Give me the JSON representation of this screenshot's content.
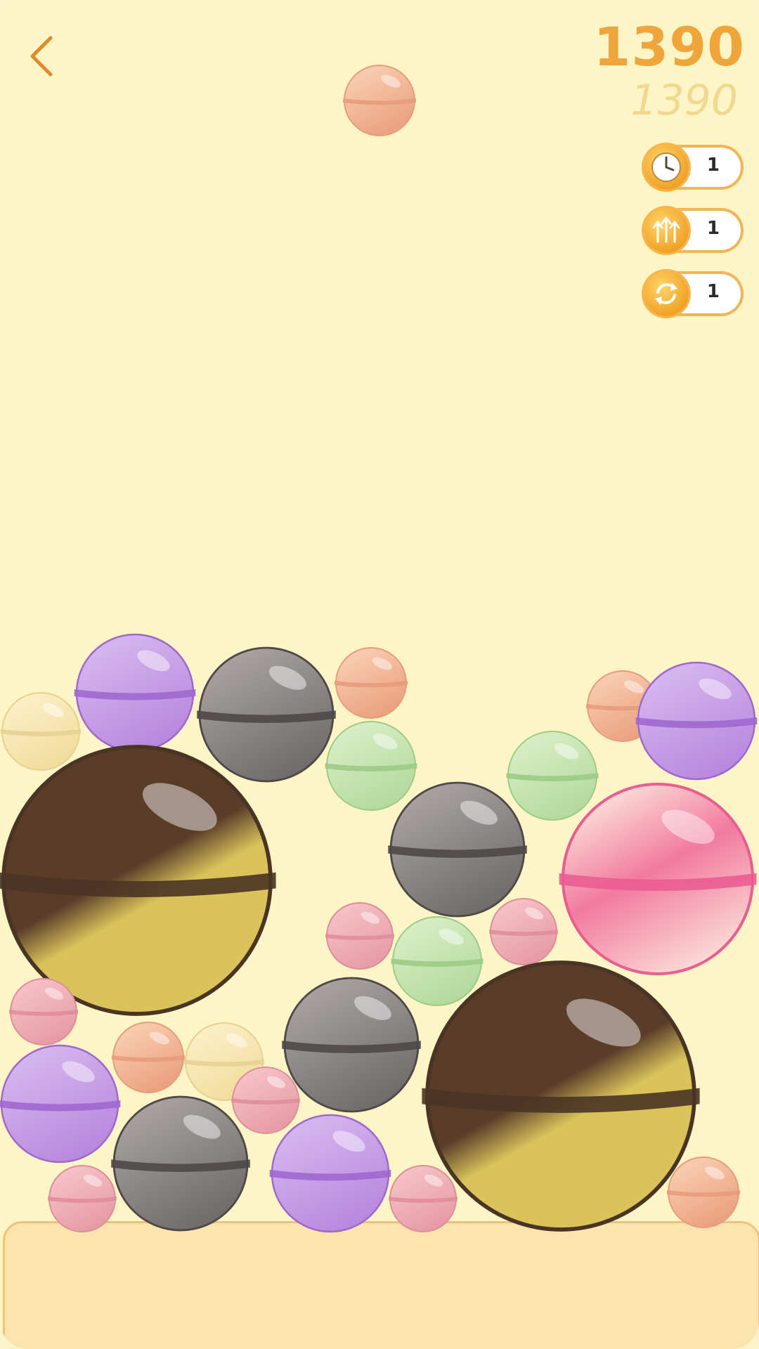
{
  "score": {
    "current": "1390",
    "best": "1390"
  },
  "powerups": [
    {
      "icon": "clock-icon",
      "count": "1"
    },
    {
      "icon": "arrows-up-icon",
      "count": "1"
    },
    {
      "icon": "refresh-icon",
      "count": "1"
    }
  ],
  "colors": {
    "background": "#fef5c6",
    "score": "#f0a53a",
    "best_score": "#f1d890",
    "floor": "#fde3ad",
    "back_arrow": "#e08a2a"
  },
  "ball_types": {
    "peach": {
      "light": "#f9cdb0",
      "dark": "#e9a07d",
      "band": "#e79c7c"
    },
    "pink": {
      "light": "#f6c2c7",
      "dark": "#e69aa4",
      "band": "#df8e99"
    },
    "cream": {
      "light": "#fcefc6",
      "dark": "#f1dc9d",
      "band": "#e8d092"
    },
    "green": {
      "light": "#d8eec6",
      "dark": "#b2d99c",
      "band": "#9ccb86"
    },
    "purple": {
      "light": "#d6b6ef",
      "dark": "#b787dd",
      "band": "#9e68cf"
    },
    "gray": {
      "light": "#a8a2a2",
      "dark": "#6f6a6a",
      "band": "#4e4848"
    },
    "rose": {
      "light": "#fbdcd6",
      "dark": "#f27aa0",
      "band": "#ea5d90"
    },
    "chocolate": {
      "light": "#d9c35a",
      "dark": "#5a3d29",
      "band": "#4a3424"
    }
  },
  "next_ball": "peach",
  "balls": [
    {
      "type": "purple"
    },
    {
      "type": "gray"
    },
    {
      "type": "peach"
    },
    {
      "type": "cream"
    },
    {
      "type": "green"
    },
    {
      "type": "peach"
    },
    {
      "type": "purple"
    },
    {
      "type": "green"
    },
    {
      "type": "chocolate"
    },
    {
      "type": "gray"
    },
    {
      "type": "rose"
    },
    {
      "type": "pink"
    },
    {
      "type": "pink"
    },
    {
      "type": "green"
    },
    {
      "type": "pink"
    },
    {
      "type": "gray"
    },
    {
      "type": "cream"
    },
    {
      "type": "peach"
    },
    {
      "type": "chocolate"
    },
    {
      "type": "purple"
    },
    {
      "type": "pink"
    },
    {
      "type": "gray"
    },
    {
      "type": "purple"
    },
    {
      "type": "pink"
    },
    {
      "type": "pink"
    },
    {
      "type": "peach"
    }
  ]
}
